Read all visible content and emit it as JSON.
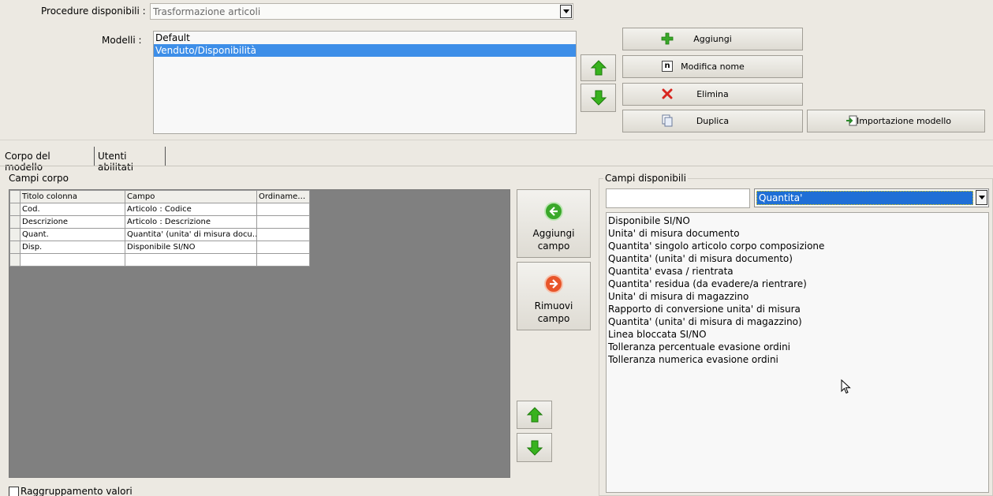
{
  "header": {
    "procedure_label": "Procedure disponibili :",
    "procedure_value": "Trasformazione articoli",
    "models_label": "Modelli :",
    "models": [
      {
        "label": "Default",
        "selected": false
      },
      {
        "label": "Venduto/Disponibilità",
        "selected": true
      }
    ]
  },
  "model_buttons": {
    "add": "Aggiungi",
    "rename": "Modifica nome",
    "delete": "Elimina",
    "duplicate": "Duplica",
    "import": "Importazione modello",
    "rename_icon_glyph": "n"
  },
  "tabs": [
    {
      "label": "Corpo del modello",
      "active": true
    },
    {
      "label": "Utenti abilitati",
      "active": false
    }
  ],
  "campi_corpo": {
    "title": "Campi corpo",
    "columns": [
      "Titolo colonna",
      "Campo",
      "Ordiname…"
    ],
    "rows": [
      [
        "Cod.",
        "Articolo : Codice",
        ""
      ],
      [
        "Descrizione",
        "Articolo : Descrizione",
        ""
      ],
      [
        "Quant.",
        "Quantita' (unita' di misura docu…",
        ""
      ],
      [
        "Disp.",
        "Disponibile SI/NO",
        ""
      ],
      [
        "",
        "",
        ""
      ]
    ]
  },
  "actions": {
    "add_field_line1": "Aggiungi",
    "add_field_line2": "campo",
    "remove_field_line1": "Rimuovi",
    "remove_field_line2": "campo"
  },
  "campi_disponibili": {
    "title": "Campi disponibili",
    "search_value": "",
    "category": "Quantita'",
    "items": [
      "Disponibile SI/NO",
      "Unita' di misura documento",
      "Quantita' singolo articolo corpo composizione",
      "Quantita' (unita' di misura documento)",
      "Quantita' evasa / rientrata",
      "Quantita' residua (da evadere/a rientrare)",
      "Unita' di misura di magazzino",
      "Rapporto di conversione unita' di misura",
      "Quantita' (unita' di misura di magazzino)",
      "Linea bloccata SI/NO",
      "Tolleranza percentuale evasione ordini",
      "Tolleranza numerica evasione ordini"
    ]
  },
  "footer": {
    "grouping_label": "Raggruppamento valori"
  },
  "colors": {
    "background": "#ece9e2",
    "selection": "#3d8ee8",
    "arrow_green": "#38b21e",
    "add_circle": "#3aa82a",
    "remove_circle": "#e8552a",
    "delete_red": "#d8261f"
  }
}
